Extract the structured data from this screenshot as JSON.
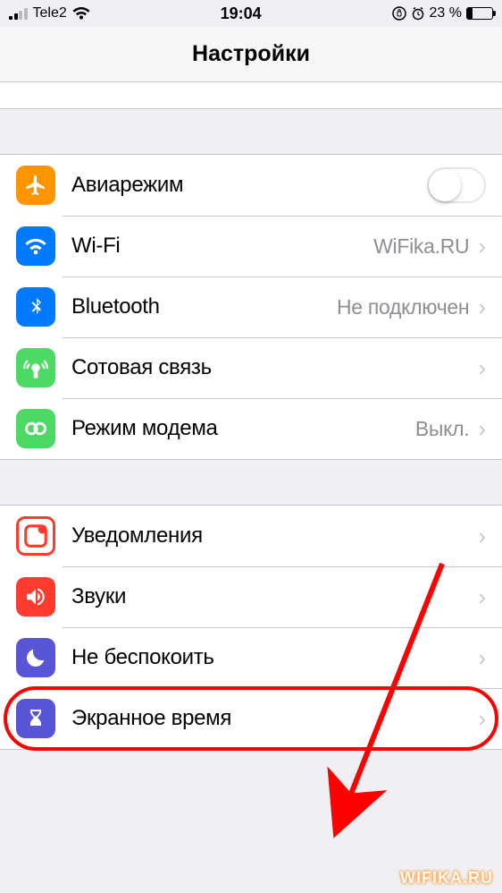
{
  "statusbar": {
    "carrier": "Tele2",
    "time": "19:04",
    "battery_pct": "23 %"
  },
  "navbar": {
    "title": "Настройки"
  },
  "group1": {
    "airplane": {
      "label": "Авиарежим"
    },
    "wifi": {
      "label": "Wi-Fi",
      "value": "WiFika.RU"
    },
    "bluetooth": {
      "label": "Bluetooth",
      "value": "Не подключен"
    },
    "cellular": {
      "label": "Сотовая связь"
    },
    "hotspot": {
      "label": "Режим модема",
      "value": "Выкл."
    }
  },
  "group2": {
    "notifications": {
      "label": "Уведомления"
    },
    "sounds": {
      "label": "Звуки"
    },
    "dnd": {
      "label": "Не беспокоить"
    },
    "screentime": {
      "label": "Экранное время"
    }
  },
  "watermark": "WIFIKA.RU"
}
